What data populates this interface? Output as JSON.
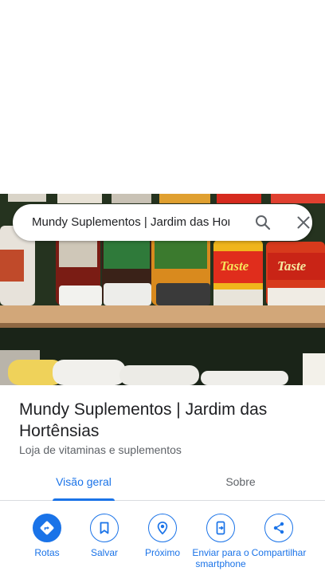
{
  "search": {
    "query": "Mundy Suplementos | Jardim das Hortênsias"
  },
  "place": {
    "name": "Mundy Suplementos | Jardim das Hortênsias",
    "category": "Loja de vitaminas e suplementos"
  },
  "tabs": [
    {
      "label": "Visão geral",
      "selected": true
    },
    {
      "label": "Sobre",
      "selected": false
    }
  ],
  "actions": [
    {
      "label": "Rotas",
      "icon": "directions-icon"
    },
    {
      "label": "Salvar",
      "icon": "bookmark-icon"
    },
    {
      "label": "Próximo",
      "icon": "nearby-icon"
    },
    {
      "label": "Enviar para o smartphone",
      "icon": "send-to-phone-icon"
    },
    {
      "label": "Compartilhar",
      "icon": "share-icon"
    }
  ],
  "hero_image": {
    "product_labels": [
      "Taste",
      "Taste"
    ]
  },
  "colors": {
    "accent": "#1a73e8",
    "text_primary": "#202124",
    "text_secondary": "#5f6368",
    "divider": "#dadce0"
  }
}
